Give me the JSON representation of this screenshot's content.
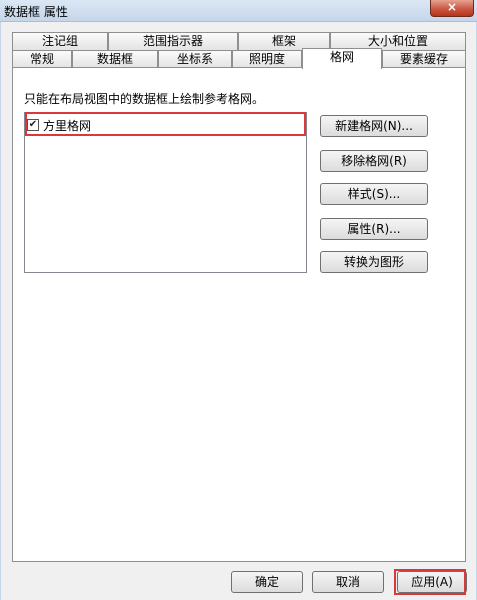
{
  "window": {
    "title": "数据框 属性",
    "close_glyph": "×"
  },
  "tabs_back": [
    "注记组",
    "范围指示器",
    "框架",
    "大小和位置"
  ],
  "tabs_front": [
    "常规",
    "数据框",
    "坐标系",
    "照明度",
    "格网",
    "要素缓存"
  ],
  "active_tab": "格网",
  "grid_panel": {
    "hint": "只能在布局视图中的数据框上绘制参考格网。",
    "grids": [
      {
        "label": "方里格网",
        "checked": true,
        "check_glyph": "✔"
      }
    ],
    "buttons": {
      "new_grid": "新建格网(N)...",
      "remove_grid": "移除格网(R)",
      "style": "样式(S)...",
      "properties": "属性(R)...",
      "convert": "转换为图形"
    }
  },
  "footer": {
    "ok": "确定",
    "cancel": "取消",
    "apply": "应用(A)"
  },
  "colors": {
    "highlight": "#d9393a"
  }
}
